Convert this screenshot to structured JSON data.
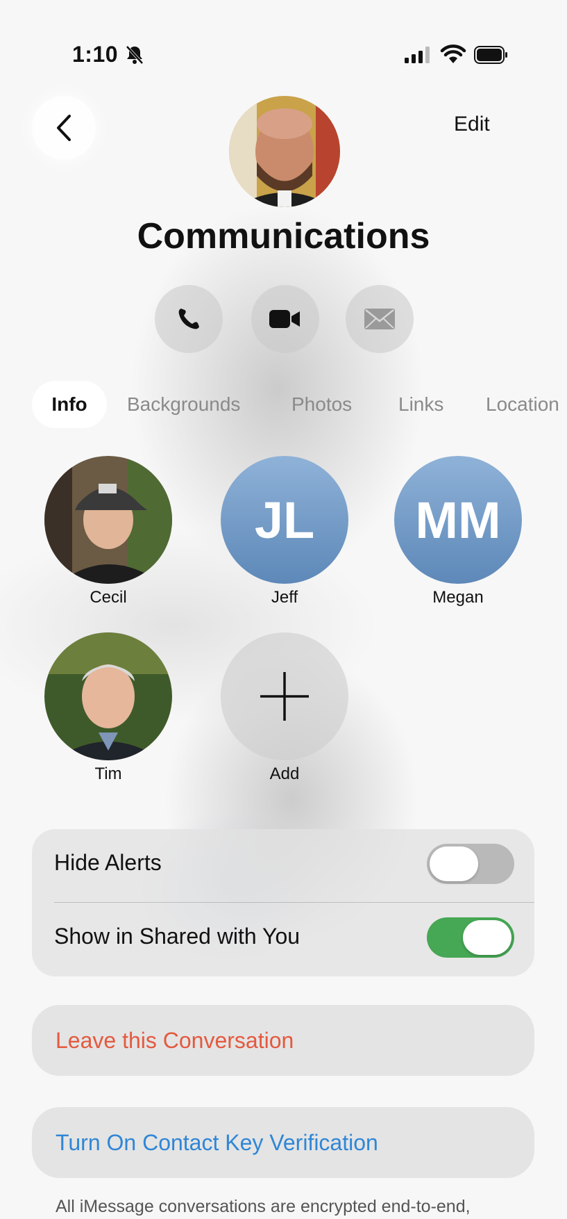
{
  "status_bar": {
    "time": "1:10",
    "icons": [
      "bell-slash-icon",
      "cellular-signal-icon",
      "wifi-icon",
      "battery-icon"
    ]
  },
  "header": {
    "back_icon": "chevron-left-icon",
    "edit_label": "Edit",
    "group_name": "Communications"
  },
  "actions": [
    {
      "icon": "phone-icon"
    },
    {
      "icon": "video-camera-icon"
    },
    {
      "icon": "envelope-icon"
    }
  ],
  "tabs": [
    {
      "label": "Info",
      "selected": true
    },
    {
      "label": "Backgrounds",
      "selected": false
    },
    {
      "label": "Photos",
      "selected": false
    },
    {
      "label": "Links",
      "selected": false
    },
    {
      "label": "Location",
      "selected": false
    }
  ],
  "members": [
    {
      "name": "Cecil",
      "type": "photo"
    },
    {
      "name": "Jeff",
      "type": "initials",
      "initials": "JL"
    },
    {
      "name": "Megan",
      "type": "initials",
      "initials": "MM"
    },
    {
      "name": "Tim",
      "type": "photo"
    },
    {
      "name": "Add",
      "type": "add",
      "icon": "plus-icon"
    }
  ],
  "settings": {
    "hide_alerts": {
      "label": "Hide Alerts",
      "on": false
    },
    "show_shared": {
      "label": "Show in Shared with You",
      "on": true
    }
  },
  "leave_label": "Leave this Conversation",
  "verify_label": "Turn On Contact Key Verification",
  "footer": "All iMessage conversations are encrypted end-to-end,",
  "colors": {
    "destructive": "#e4593f",
    "link": "#2f86d6",
    "toggle_on": "#46a754",
    "initials_avatar": "#6f97c6"
  }
}
